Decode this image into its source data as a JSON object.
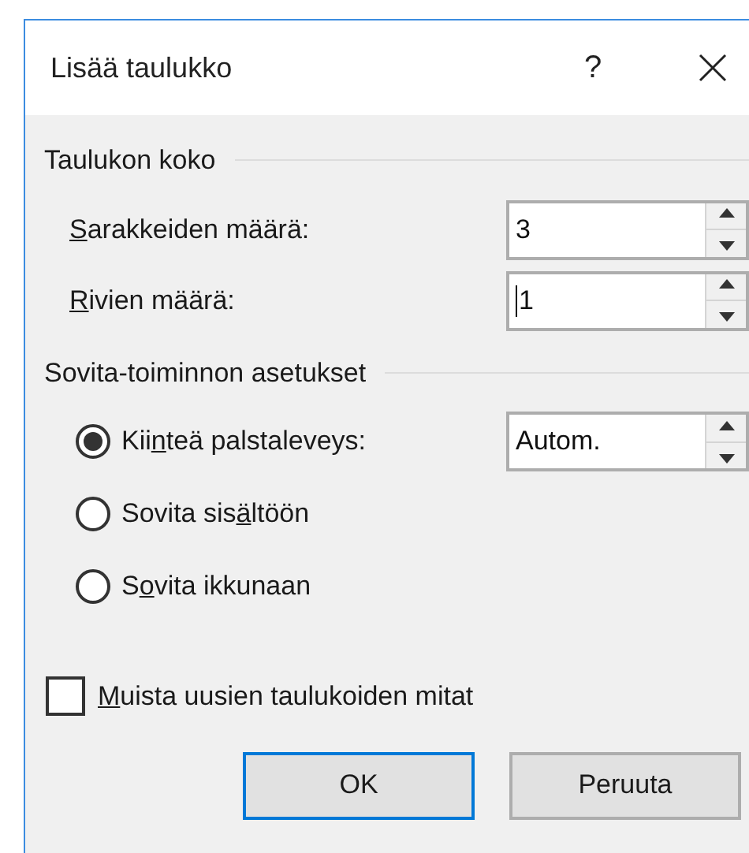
{
  "window": {
    "title": "Lisää taulukko",
    "help": "?"
  },
  "size_group": {
    "heading": "Taulukon koko",
    "fields": [
      {
        "label": {
          "key": "S",
          "post": "arakkeiden määrä:"
        },
        "value": "3",
        "focused": false
      },
      {
        "label": {
          "key": "R",
          "post": "ivien määrä:"
        },
        "value": "1",
        "focused": true
      }
    ]
  },
  "fit_group": {
    "heading": "Sovita-toiminnon asetukset",
    "options": [
      {
        "label": {
          "pre": "Kii",
          "key": "n",
          "post": "teä palstaleveys:"
        },
        "selected": true,
        "value": "Autom."
      },
      {
        "label": {
          "pre": "Sovita sis",
          "key": "ä",
          "post": "ltöön"
        },
        "selected": false
      },
      {
        "label": {
          "pre": "S",
          "key": "o",
          "post": "vita ikkunaan"
        },
        "selected": false
      }
    ]
  },
  "remember": {
    "label": {
      "key": "M",
      "post": "uista uusien taulukoiden mitat"
    },
    "checked": false
  },
  "buttons": [
    {
      "label": "OK",
      "default": true
    },
    {
      "label": "Peruuta",
      "default": false
    }
  ]
}
